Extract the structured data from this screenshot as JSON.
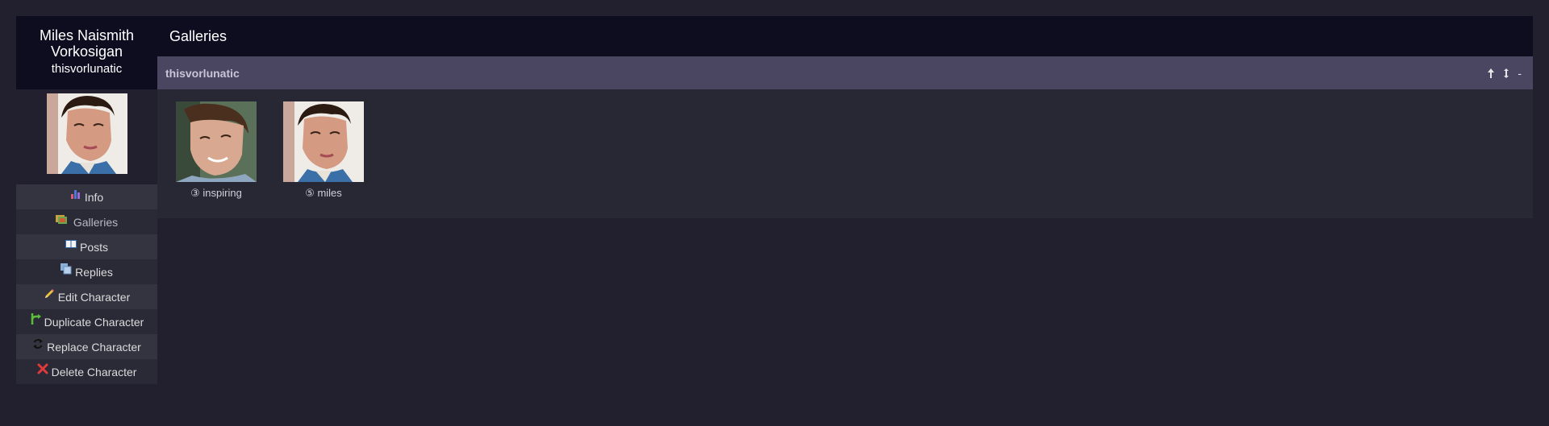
{
  "character": {
    "name": "Miles Naismith Vorkosigan",
    "screenname": "thisvorlunatic"
  },
  "sidebar": {
    "items": [
      {
        "label": "Info",
        "icon": "chart-icon"
      },
      {
        "label": "Galleries",
        "icon": "gallery-icon"
      },
      {
        "label": "Posts",
        "icon": "book-icon"
      },
      {
        "label": "Replies",
        "icon": "replies-icon"
      },
      {
        "label": "Edit Character",
        "icon": "pencil-icon"
      },
      {
        "label": "Duplicate Character",
        "icon": "branch-icon"
      },
      {
        "label": "Replace Character",
        "icon": "refresh-icon"
      },
      {
        "label": "Delete Character",
        "icon": "x-icon"
      }
    ]
  },
  "main": {
    "title": "Galleries",
    "gallery": {
      "owner": "thisvorlunatic",
      "controls": [
        "↑",
        "↕",
        "-"
      ],
      "icons": [
        {
          "caption": "③ inspiring"
        },
        {
          "caption": "⑤ miles"
        }
      ]
    }
  },
  "colors": {
    "background": "#22202f",
    "header_bg": "#0e0d20",
    "gallery_header_bg": "#4a4560",
    "gallery_body_bg": "#282734",
    "delete_red": "#e03a3a",
    "duplicate_green": "#5cbf3a"
  }
}
